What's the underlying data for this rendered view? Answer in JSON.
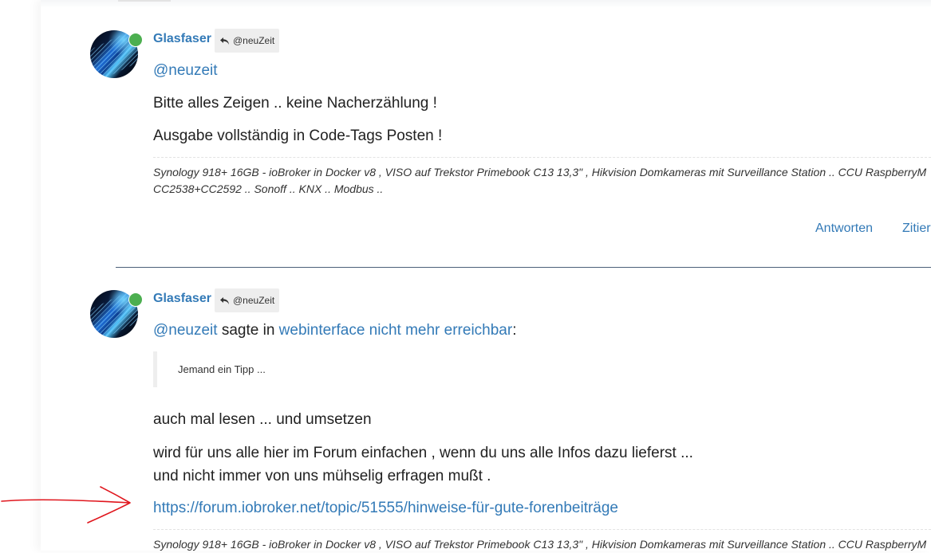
{
  "post1": {
    "username": "Glasfaser",
    "reply_to": "@neuZeit",
    "mention": "@neuzeit",
    "line1": "Bitte alles Zeigen .. keine Nacherzählung !",
    "line2": "Ausgabe vollständig in Code-Tags Posten !",
    "signature_line1": "Synology 918+ 16GB - ioBroker in Docker v8 , VISO auf Trekstor Primebook C13 13,3\" , Hikvision Domkameras mit Surveillance Station .. CCU RaspberryM",
    "signature_line2": "CC2538+CC2592 .. Sonoff .. KNX .. Modbus ..",
    "actions": {
      "reply": "Antworten",
      "quote": "Zitier"
    }
  },
  "post2": {
    "username": "Glasfaser",
    "reply_to": "@neuZeit",
    "mention": "@neuzeit",
    "said_in": " sagte in ",
    "topic_link": "webinterface nicht mehr erreichbar",
    "colon": ":",
    "quote_text": "Jemand ein Tipp ...",
    "line1": "auch mal lesen ... und umsetzen",
    "line2": "wird für uns alle hier im Forum einfachen , wenn du uns alle Infos dazu lieferst ...",
    "line3": "und nicht immer von uns mühselig erfragen mußt .",
    "link_url": "https://forum.iobroker.net/topic/51555/hinweise-für-gute-forenbeiträge",
    "signature_line1": "Synology 918+ 16GB - ioBroker in Docker v8 , VISO auf Trekstor Primebook C13 13,3\" , Hikvision Domkameras mit Surveillance Station .. CCU RaspberryM"
  },
  "colors": {
    "link": "#337ab7",
    "online": "#4caf50",
    "annotation_arrow": "#e0161d"
  }
}
